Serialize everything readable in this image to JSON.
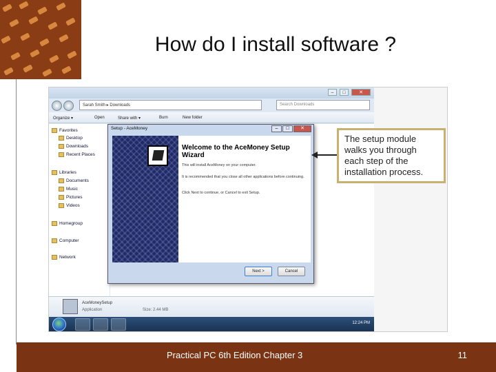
{
  "slide": {
    "title": "How do I install software ?",
    "footer_text": "Practical PC 6th Edition Chapter 3",
    "page_number": "11"
  },
  "explorer": {
    "breadcrumb": "Sarah Smith ▸ Downloads",
    "search_placeholder": "Search Downloads",
    "toolbar": [
      "Organize ▾",
      "Open",
      "Share with ▾",
      "Burn",
      "New folder"
    ],
    "nav": {
      "favorites": "Favorites",
      "favorites_items": [
        "Desktop",
        "Downloads",
        "Recent Places"
      ],
      "libraries": "Libraries",
      "libraries_items": [
        "Documents",
        "Music",
        "Pictures",
        "Videos"
      ],
      "homegroup": "Homegroup",
      "computer": "Computer",
      "network": "Network"
    },
    "details": {
      "name": "AceMoneySetup",
      "type": "Application",
      "size": "Size: 2.44 MB"
    },
    "clock": "12:24 PM"
  },
  "wizard": {
    "title": "Setup - AceMoney",
    "heading": "Welcome to the AceMoney Setup Wizard",
    "line1": "This will install AceMoney on your computer.",
    "line2": "It is recommended that you close all other applications before continuing.",
    "line3": "Click Next to continue, or Cancel to exit Setup.",
    "next": "Next >",
    "cancel": "Cancel"
  },
  "callout": "The setup module walks you through each step of the installation process.",
  "colors": {
    "footer": "#7b3413",
    "callout_border": "#c9b070"
  }
}
